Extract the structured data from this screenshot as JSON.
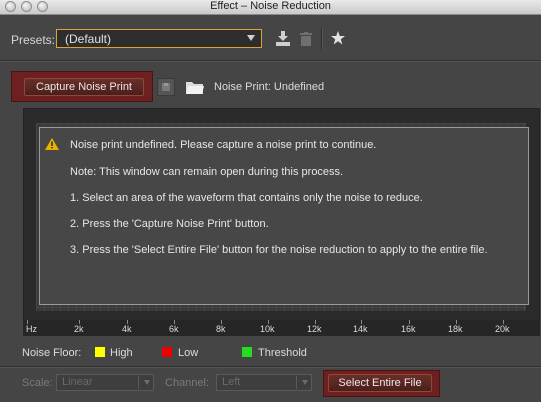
{
  "window": {
    "title": "Effect – Noise Reduction"
  },
  "presets": {
    "label": "Presets:",
    "value": "(Default)",
    "icons": [
      "save-preset-icon",
      "delete-preset-icon",
      "favorite-star-icon"
    ]
  },
  "capture": {
    "button_label": "Capture Noise Print",
    "noise_print_label": "Noise Print: Undefined",
    "icons": [
      "save-noise-print-icon",
      "open-folder-icon"
    ]
  },
  "message": {
    "warning_icon": "warning-icon",
    "lines": [
      "Noise print undefined. Please capture a noise print to continue.",
      "Note: This window can remain open during this process.",
      "1. Select an area of the waveform that contains only the noise to reduce.",
      "2. Press the 'Capture Noise Print' button.",
      "3. Press the 'Select Entire File' button for the noise reduction to apply to the entire file."
    ]
  },
  "ruler": {
    "labels": [
      "Hz",
      "2k",
      "4k",
      "6k",
      "8k",
      "10k",
      "12k",
      "14k",
      "16k",
      "18k",
      "20k"
    ]
  },
  "legend": {
    "label": "Noise Floor:",
    "items": [
      {
        "label": "High",
        "color": "#ffff00"
      },
      {
        "label": "Low",
        "color": "#ee0000"
      },
      {
        "label": "Threshold",
        "color": "#22dd22"
      }
    ]
  },
  "bottom": {
    "scale_label": "Scale:",
    "scale_value": "Linear",
    "channel_label": "Channel:",
    "channel_value": "Left",
    "select_entire_file_label": "Select Entire File"
  }
}
